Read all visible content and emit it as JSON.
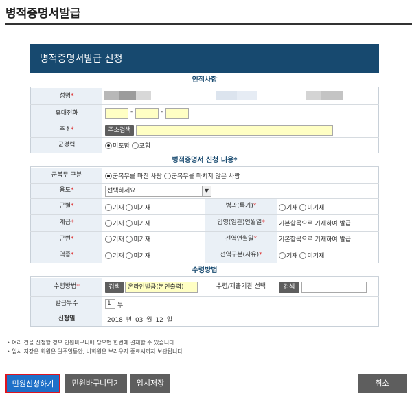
{
  "page": {
    "title": "병적증명서발급"
  },
  "form": {
    "header": "병적증명서발급 신청",
    "sections": {
      "personal": "인적사항",
      "request": "병적증명서 신청 내용",
      "receive": "수령방법"
    },
    "personal": {
      "name_label": "성명",
      "phone_label": "휴대전화",
      "phone_sep": "-",
      "address_label": "주소",
      "address_btn": "주소검색",
      "military_history_label": "군경력",
      "military_history_options": [
        "미포함",
        "포함"
      ],
      "military_history_selected": "미포함"
    },
    "request": {
      "service_type_label": "군복무 구분",
      "service_type_options": [
        "군복무를 마친 사람",
        "군복무를 마치지 않은 사람"
      ],
      "service_type_selected": "군복무를 마친 사람",
      "purpose_label": "용도",
      "purpose_value": "선택하세요",
      "branch_label": "군별",
      "specialty_label": "병과(특기)",
      "rank_label": "계급",
      "enlist_date_label": "입영(임관)연월일",
      "enlist_date_note": "기본항목으로 기재하여 발급",
      "service_number_label": "군번",
      "discharge_date_label": "전역연월일",
      "discharge_date_note": "기본항목으로 기재하여 발급",
      "role_label": "역종",
      "discharge_reason_label": "전역구분(사유)",
      "choice_options": [
        "기재",
        "미기재"
      ]
    },
    "receive": {
      "method_label": "수령방법",
      "search_btn": "검색",
      "method_value": "온라인발급(본인출력)",
      "agency_label": "수령/제출기관 선택",
      "agency_search_btn": "검색",
      "copies_label": "발급부수",
      "copies_value": "1",
      "copies_unit": "부",
      "date_label": "신청일",
      "date_year": "2018",
      "date_year_unit": "년",
      "date_month": "03",
      "date_month_unit": "월",
      "date_day": "12",
      "date_day_unit": "일"
    }
  },
  "notice": [
    "• 여러 건을 신청할 경우 민원바구니에 담으면 한번에 결제할 수 있습니다.",
    "• 임시 저장은 회원은 일주일동안, 비회원은 브라우저 종료시까지 보관됩니다."
  ],
  "buttons": {
    "apply": "민원신청하기",
    "basket": "민원바구니담기",
    "temp_save": "임시저장",
    "cancel": "취소"
  },
  "required_mark": "*",
  "colors": {
    "header_bg": "#17496f",
    "label_bg": "#eaf0f6",
    "apply_btn": "#1e70c8",
    "apply_border": "#e0141e",
    "gray_btn": "#5e5e5e",
    "input_yellow": "#ffffc4"
  }
}
